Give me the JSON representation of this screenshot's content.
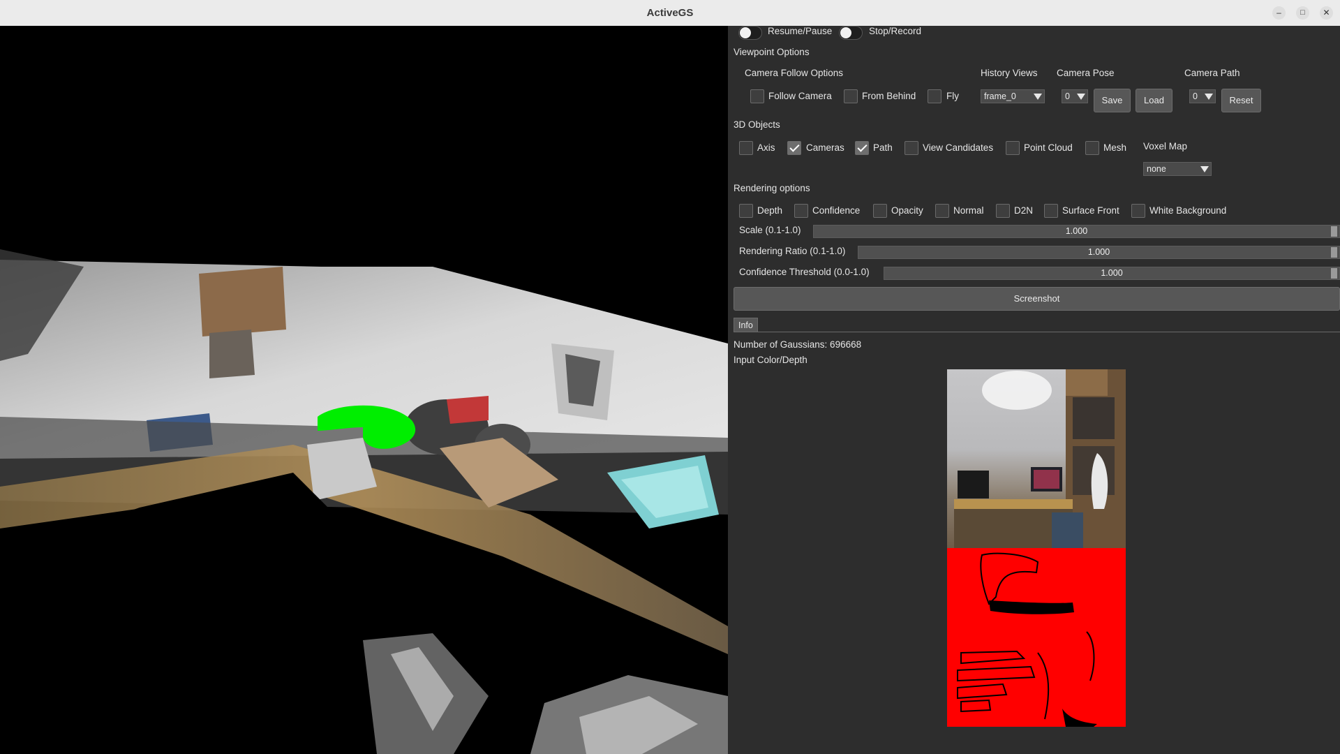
{
  "window": {
    "title": "ActiveGS",
    "minimize_glyph": "–",
    "maximize_glyph": "□",
    "close_glyph": "✕"
  },
  "top_controls": {
    "resume_pause": "Resume/Pause",
    "stop_record": "Stop/Record"
  },
  "viewpoint": {
    "section": "Viewpoint Options",
    "camera_follow_header": "Camera Follow Options",
    "follow_camera": "Follow Camera",
    "from_behind": "From Behind",
    "fly": "Fly",
    "history_views_header": "History Views",
    "history_views_value": "frame_0",
    "camera_pose_header": "Camera Pose",
    "camera_pose_value": "0",
    "save": "Save",
    "load": "Load",
    "camera_path_header": "Camera Path",
    "camera_path_value": "0",
    "reset": "Reset"
  },
  "objects": {
    "section": "3D Objects",
    "axis": "Axis",
    "cameras": "Cameras",
    "path": "Path",
    "view_candidates": "View Candidates",
    "point_cloud": "Point Cloud",
    "mesh": "Mesh",
    "voxel_map_header": "Voxel Map",
    "voxel_map_value": "none",
    "checked": {
      "axis": false,
      "cameras": true,
      "path": true,
      "view_candidates": false,
      "point_cloud": false,
      "mesh": false
    }
  },
  "rendering": {
    "section": "Rendering options",
    "depth": "Depth",
    "confidence": "Confidence",
    "opacity": "Opacity",
    "normal": "Normal",
    "d2n": "D2N",
    "surface_front": "Surface Front",
    "white_background": "White Background",
    "scale_label": "Scale (0.1-1.0)",
    "scale_value": "1.000",
    "ratio_label": "Rendering Ratio (0.1-1.0)",
    "ratio_value": "1.000",
    "threshold_label": "Confidence Threshold (0.0-1.0)",
    "threshold_value": "1.000",
    "screenshot": "Screenshot"
  },
  "info": {
    "tab": "Info",
    "gaussians": "Number of Gaussians: 696668",
    "input_label": "Input Color/Depth"
  },
  "colors": {
    "panel_bg": "#2d2d2d",
    "viewport_bg": "#000000",
    "depth_map": "#ff0000",
    "camera_marker": "#00ee00"
  }
}
